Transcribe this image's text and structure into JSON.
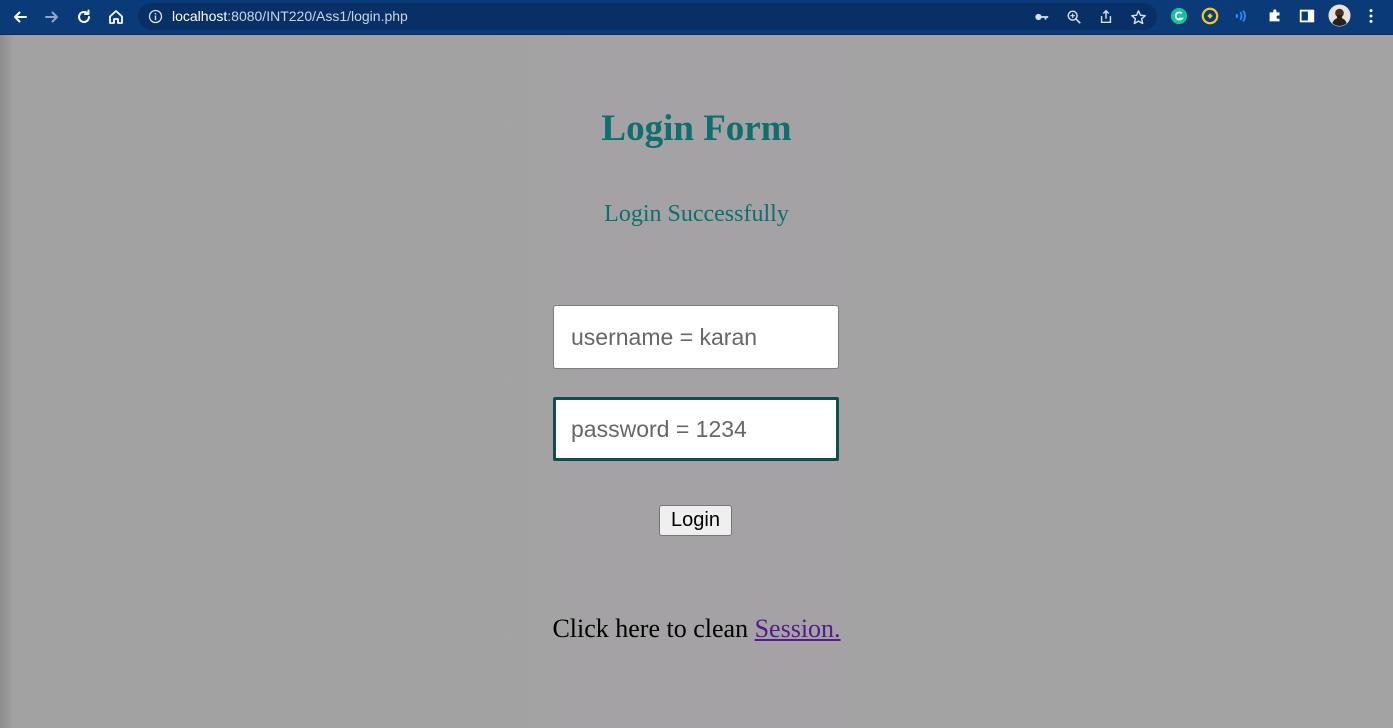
{
  "browser": {
    "url_host": "localhost",
    "url_rest": ":8080/INT220/Ass1/login.php"
  },
  "page": {
    "title": "Login Form",
    "status_message": "Login Successfully",
    "username_placeholder": "username = karan",
    "password_placeholder": "password = 1234",
    "login_button_label": "Login",
    "session_text": "Click here to clean ",
    "session_link": "Session."
  },
  "colors": {
    "heading": "#0e6f6d",
    "page_background": "#a4a3a4",
    "toolbar": "#0b3a78",
    "link_visited": "#551a8b"
  }
}
